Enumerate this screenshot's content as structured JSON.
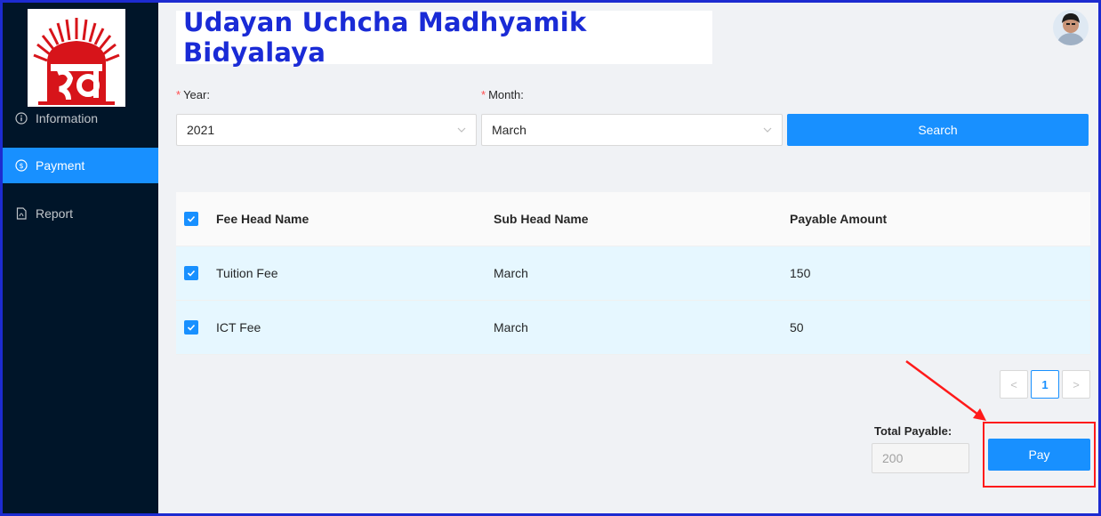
{
  "header": {
    "title": "Udayan Uchcha Madhyamik Bidyalaya"
  },
  "sidebar": {
    "items": [
      {
        "label": "Information",
        "icon": "info-circle-icon"
      },
      {
        "label": "Payment",
        "icon": "dollar-circle-icon",
        "active": true
      },
      {
        "label": "Report",
        "icon": "file-pdf-icon"
      }
    ]
  },
  "filters": {
    "year_label": "Year:",
    "year_value": "2021",
    "month_label": "Month:",
    "month_value": "March",
    "search_label": "Search"
  },
  "table": {
    "columns": [
      "Fee Head Name",
      "Sub Head Name",
      "Payable Amount"
    ],
    "rows": [
      {
        "fee_head": "Tuition Fee",
        "sub_head": "March",
        "amount": "150",
        "checked": true
      },
      {
        "fee_head": "ICT Fee",
        "sub_head": "March",
        "amount": "50",
        "checked": true
      }
    ]
  },
  "pagination": {
    "current": "1"
  },
  "footer": {
    "total_label": "Total Payable:",
    "total_value": "200",
    "pay_label": "Pay"
  },
  "colors": {
    "sidebar_bg": "#001529",
    "primary": "#1890ff",
    "title_text": "#1a2bd6",
    "annotation_red": "#ff1a1a",
    "frame_border": "#1d2bd0"
  }
}
